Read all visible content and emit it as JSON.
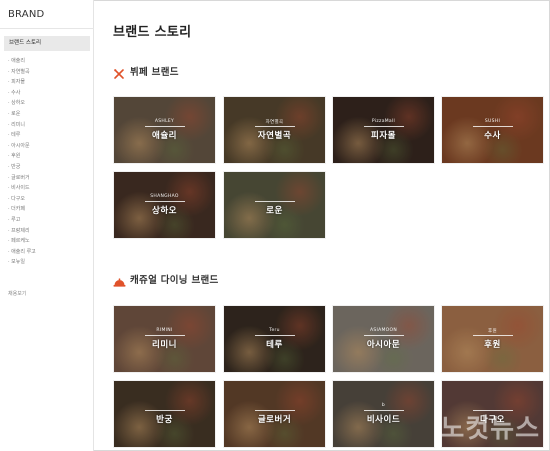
{
  "sidebar": {
    "brand": "BRAND",
    "active_item": "브랜드 스토리",
    "items": [
      "· 애슐리",
      "· 자연별곡",
      "· 피자몰",
      "· 수사",
      "· 상하오",
      "· 로운",
      "· 리미니",
      "· 테루",
      "· 아시아문",
      "· 후원",
      "· 반궁",
      "· 글로버거",
      "· 비사이드",
      "· 다구오",
      "· 더카페",
      "· 루고",
      "· 프랑제리",
      "· 페르케노",
      "· 애슐리 루고",
      "· 모뉴일"
    ],
    "extra_link": "채용보기"
  },
  "main": {
    "title": "브랜드 스토리",
    "sections": [
      {
        "label": "뷔페 브랜드",
        "icon": "fork-knife-icon",
        "cards": [
          {
            "logo": "ASHLEY",
            "name": "애슐리",
            "bg": "#6b5a48"
          },
          {
            "logo": "자연별곡",
            "name": "자연별곡",
            "bg": "#5a4a32"
          },
          {
            "logo": "PizzaMall",
            "name": "피자몰",
            "bg": "#3a2a22"
          },
          {
            "logo": "SUSHI",
            "name": "수사",
            "bg": "#8a4a2a"
          },
          {
            "logo": "SHANGHAO",
            "name": "상하오",
            "bg": "#4a3428"
          },
          {
            "logo": "",
            "name": "로운",
            "bg": "#5a5a42"
          }
        ]
      },
      {
        "label": "캐쥬얼 다이닝 브랜드",
        "icon": "cloche-icon",
        "cards": [
          {
            "logo": "RIMINI",
            "name": "리미니",
            "bg": "#7a5a48"
          },
          {
            "logo": "Teru",
            "name": "테루",
            "bg": "#3a2e24"
          },
          {
            "logo": "ASIAMOON",
            "name": "아시아문",
            "bg": "#8a8278"
          },
          {
            "logo": "후원",
            "name": "후원",
            "bg": "#b27a52"
          },
          {
            "logo": "",
            "name": "반궁",
            "bg": "#4a3a2a"
          },
          {
            "logo": "",
            "name": "글로버거",
            "bg": "#6a4830"
          },
          {
            "logo": "b",
            "name": "비사이드",
            "bg": "#5a5248"
          },
          {
            "logo": "",
            "name": "다구오",
            "bg": "#6a4a44"
          }
        ]
      }
    ]
  },
  "watermark": "노컷뉴스",
  "colors": {
    "accent": "#e0522a",
    "sidebar_active_bg": "#e9e9e9"
  }
}
